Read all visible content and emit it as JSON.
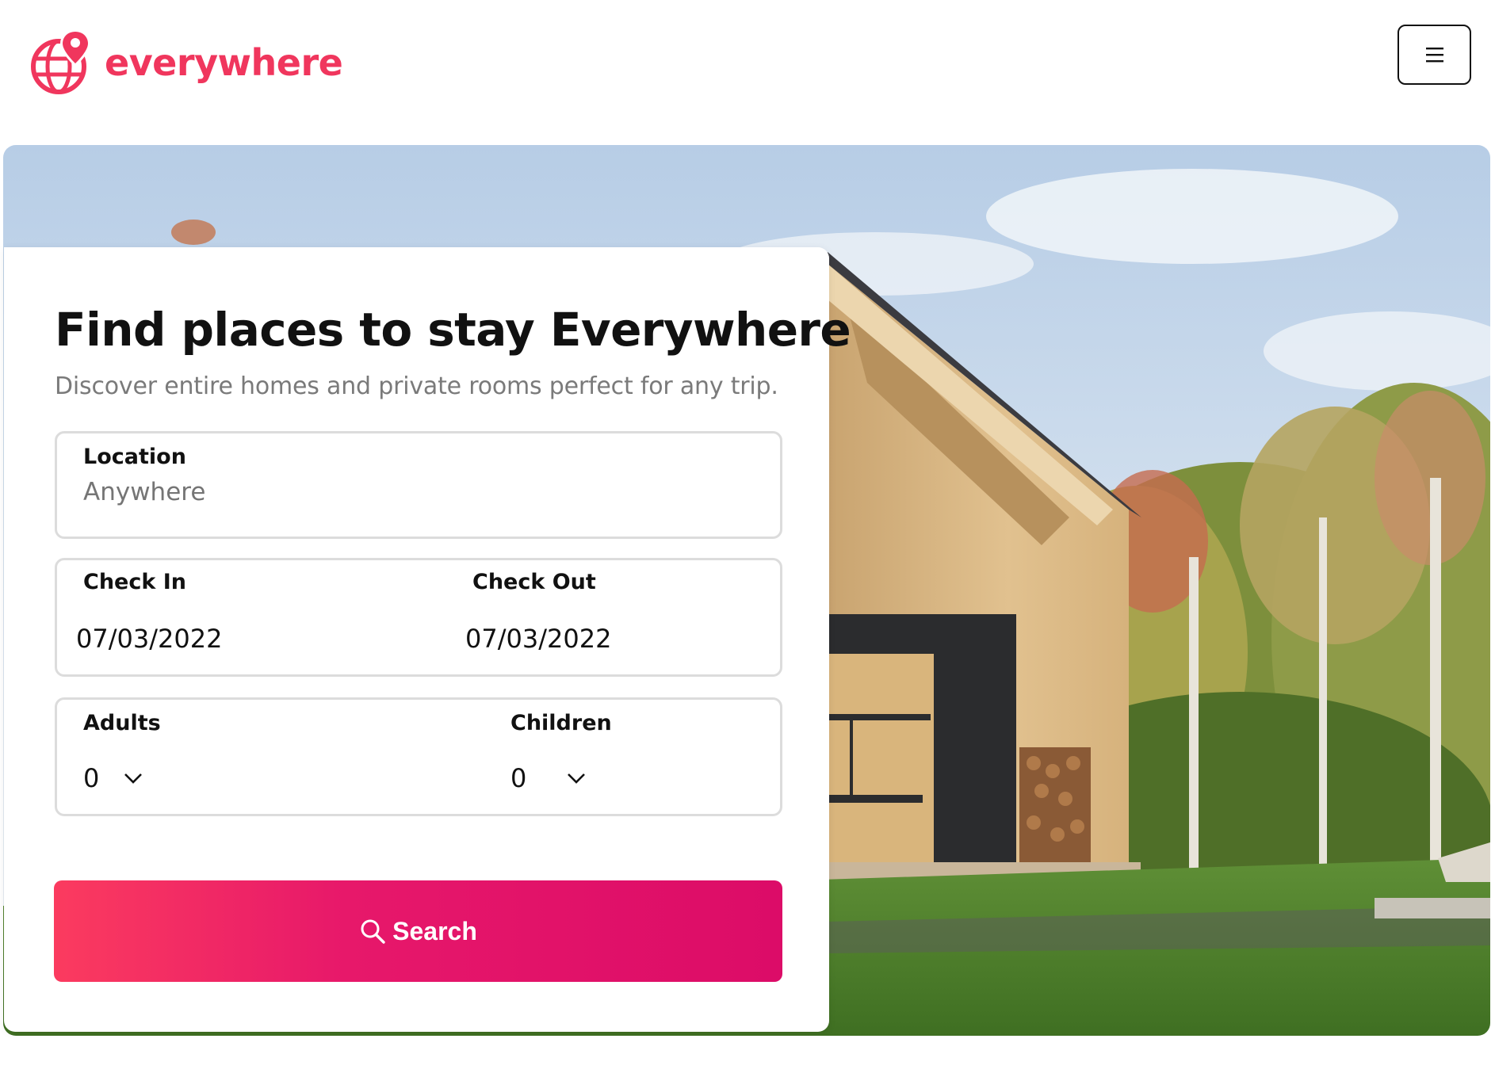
{
  "brand": {
    "name": "everywhere",
    "accent_color": "#f0365d",
    "logo_icon": "globe-pin-icon"
  },
  "header": {
    "menu_icon": "hamburger-menu-icon"
  },
  "hero": {
    "image": "wooden-cabin-in-forest"
  },
  "search_card": {
    "title": "Find places to stay Everywhere",
    "subtitle": "Discover entire homes and private rooms perfect for any trip.",
    "location": {
      "label": "Location",
      "placeholder": "Anywhere"
    },
    "check_in": {
      "label": "Check In",
      "value": "07/03/2022"
    },
    "check_out": {
      "label": "Check Out",
      "value": "07/03/2022"
    },
    "adults": {
      "label": "Adults",
      "value": "0",
      "icon": "chevron-down-icon"
    },
    "children": {
      "label": "Children",
      "value": "0",
      "icon": "chevron-down-icon"
    },
    "search_button": {
      "label": "Search",
      "icon": "search-icon",
      "gradient_start": "#fb3b5f",
      "gradient_end": "#dc0c68"
    }
  }
}
